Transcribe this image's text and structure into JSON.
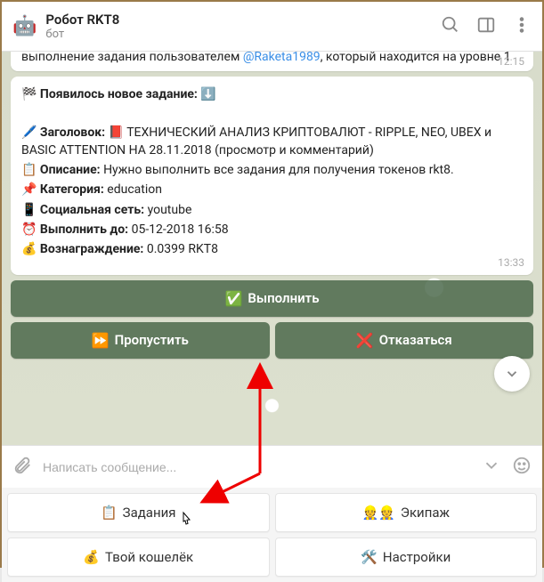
{
  "header": {
    "avatar": "🤖",
    "title": "Робот RKT8",
    "subtitle": "бот"
  },
  "messages": {
    "partial": {
      "text_prefix": "выполнение задания пользователем ",
      "mention": "@Raketa1989",
      "text_mid": ", который находится на уровне ",
      "level": "1",
      "time": "12:15"
    },
    "task": {
      "new_task_label": "Появилось новое задание:",
      "header_label": "Заголовок:",
      "header_value": "ТЕХНИЧЕСКИЙ АНАЛИЗ КРИПТОВАЛЮТ - RIPPLE, NEO, UBEX и BASIC ATTENTION НА 28.11.2018 (просмотр и комментарий)",
      "desc_label": "Описание:",
      "desc_value": "Нужно выполнить все задания для получения токенов rkt8.",
      "cat_label": "Категория:",
      "cat_value": "education",
      "net_label": "Социальная сеть:",
      "net_value": "youtube",
      "until_label": "Выполнить до:",
      "until_value": "05-12-2018 16:58",
      "reward_label": "Вознаграждение:",
      "reward_value": "0.0399 RKT8",
      "time": "13:33"
    }
  },
  "inline_buttons": {
    "do": "Выполнить",
    "skip": "Пропустить",
    "refuse": "Отказаться"
  },
  "input": {
    "placeholder": "Написать сообщение..."
  },
  "menu": {
    "tasks": "Задания",
    "crew": "Экипаж",
    "wallet": "Твой кошелёк",
    "settings": "Настройки"
  },
  "emoji": {
    "flag": "🏁",
    "down": "⬇️",
    "pen": "🖊️",
    "book": "📕",
    "clipboard": "📋",
    "pin": "📌",
    "phone": "📱",
    "clock": "⏰",
    "moneybag": "💰",
    "check": "✅",
    "fwd": "⏩",
    "cross": "❌",
    "crew": "👷👷",
    "tools": "🛠️"
  }
}
